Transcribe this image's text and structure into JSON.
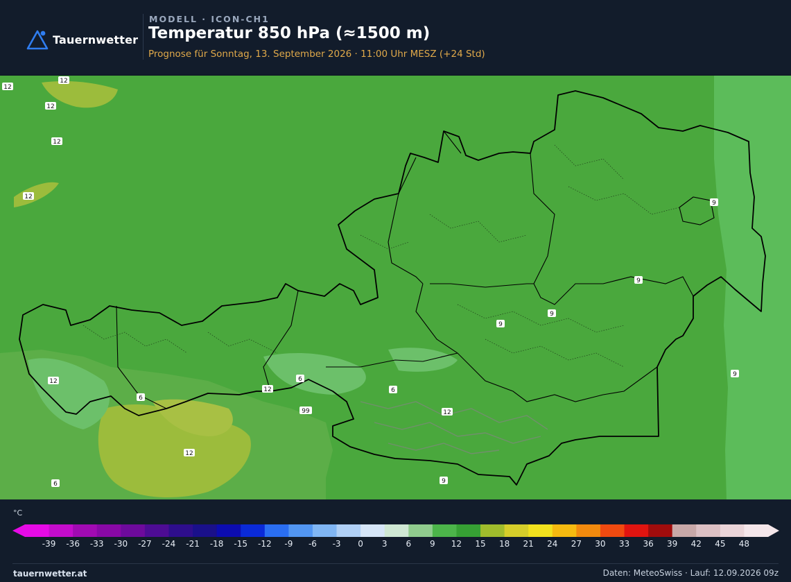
{
  "brand": {
    "name": "Tauernwetter",
    "logo_icon": "triangle-mountain-icon"
  },
  "header": {
    "model_label": "MODELL · ICON-CH1",
    "title": "Temperatur 850 hPa (≈1500 m)",
    "forecast": "Prognose für Sonntag, 13. September 2026 · 11:00 Uhr MESZ  (+24 Std)"
  },
  "map": {
    "region": "Österreich",
    "contour_labels": [
      "12",
      "12",
      "12",
      "12",
      "12",
      "12",
      "9",
      "9",
      "9",
      "9",
      "9",
      "9",
      "6",
      "6",
      "6",
      "6",
      "99",
      "12",
      "12",
      "12"
    ],
    "colors": {
      "field_main": "#4aa83d",
      "field_warm": "#9cbc3c",
      "field_cool": "#6cc06a",
      "field_east": "#5cbc5a",
      "border": "#000000"
    }
  },
  "legend": {
    "unit": "°C",
    "ticks": [
      "-39",
      "-36",
      "-33",
      "-30",
      "-27",
      "-24",
      "-21",
      "-18",
      "-15",
      "-12",
      "-9",
      "-6",
      "-3",
      "0",
      "3",
      "6",
      "9",
      "12",
      "15",
      "18",
      "21",
      "24",
      "27",
      "30",
      "33",
      "36",
      "39",
      "42",
      "45",
      "48"
    ],
    "colors": [
      "#e60ae6",
      "#c40ccc",
      "#a10ab3",
      "#8808a6",
      "#6d0a9c",
      "#4d0c94",
      "#2e0e8c",
      "#1a108a",
      "#0c0cb0",
      "#0a2ad8",
      "#2a6ef2",
      "#5296f2",
      "#80b6f4",
      "#b0d0f6",
      "#d6e6f8",
      "#cfe8d4",
      "#90cc8e",
      "#4cb54a",
      "#36a034",
      "#a0bc2c",
      "#d6ce2a",
      "#f2e21e",
      "#f6ba10",
      "#f28a0e",
      "#f04a10",
      "#e01410",
      "#a00c0c",
      "#c8a8a8",
      "#dcc0c4",
      "#ead4d8",
      "#f4e6ea"
    ]
  },
  "footer": {
    "site": "tauernwetter.at",
    "source": "Daten: MeteoSwiss · Lauf: 12.09.2026 09z"
  }
}
